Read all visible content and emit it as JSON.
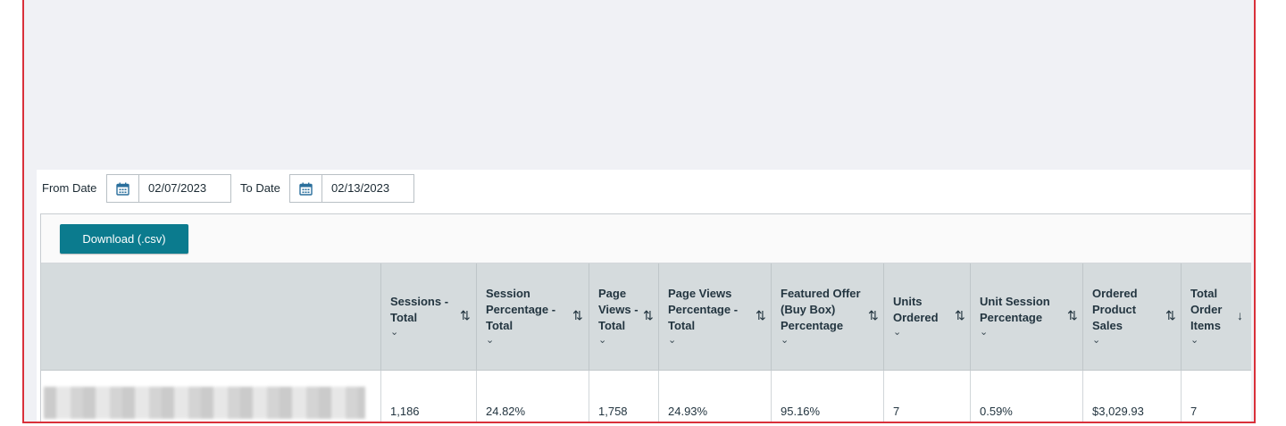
{
  "filters": {
    "from_label": "From Date",
    "from_value": "02/07/2023",
    "to_label": "To Date",
    "to_value": "02/13/2023",
    "calendar_icon": "calendar-icon"
  },
  "toolbar": {
    "download_label": "Download (.csv)"
  },
  "table": {
    "columns": [
      {
        "label": "Sessions -\nTotal",
        "sort": "⇅"
      },
      {
        "label": "Session\nPercentage -\nTotal",
        "sort": "⇅"
      },
      {
        "label": "Page\nViews -\nTotal",
        "sort": "⇅"
      },
      {
        "label": "Page Views\nPercentage -\nTotal",
        "sort": "⇅"
      },
      {
        "label": "Featured Offer\n(Buy Box)\nPercentage",
        "sort": "⇅"
      },
      {
        "label": "Units\nOrdered",
        "sort": "⇅"
      },
      {
        "label": "Unit Session\nPercentage",
        "sort": "⇅"
      },
      {
        "label": "Ordered\nProduct\nSales",
        "sort": "⇅"
      },
      {
        "label": "Total\nOrder\nItems",
        "sort": "↓"
      }
    ],
    "rows": [
      {
        "values": [
          "1,186",
          "24.82%",
          "1,758",
          "24.93%",
          "95.16%",
          "7",
          "0.59%",
          "$3,029.93",
          "7"
        ]
      }
    ]
  },
  "colors": {
    "accent": "#0b7b8e",
    "border_highlight": "#d9303a",
    "header_bg": "#d5dbdd"
  }
}
